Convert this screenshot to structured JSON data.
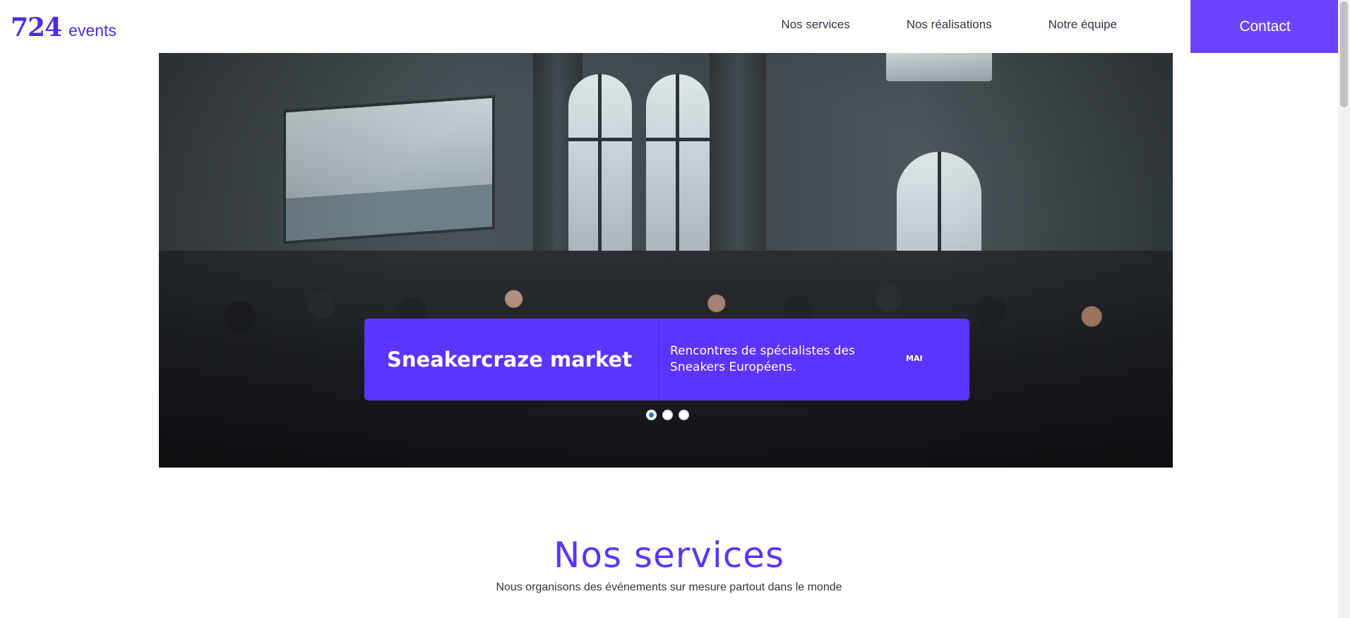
{
  "header": {
    "logo_number": "724",
    "logo_word": "events",
    "nav": [
      {
        "label": "Nos services"
      },
      {
        "label": "Nos réalisations"
      },
      {
        "label": "Notre équipe"
      }
    ],
    "contact_label": "Contact"
  },
  "hero": {
    "title": "Sneakercraze market",
    "description": "Rencontres de spécialistes des Sneakers Européens.",
    "month": "MAI",
    "slides_count": 3,
    "active_slide": 1
  },
  "services": {
    "title": "Nos services",
    "subtitle": "Nous organisons des événements sur mesure partout dans le monde"
  },
  "colors": {
    "accent": "#5b35ff",
    "contact_bg": "#6b45ff",
    "logo": "#4b2ce8",
    "active_dot": "#1e7ad8"
  }
}
